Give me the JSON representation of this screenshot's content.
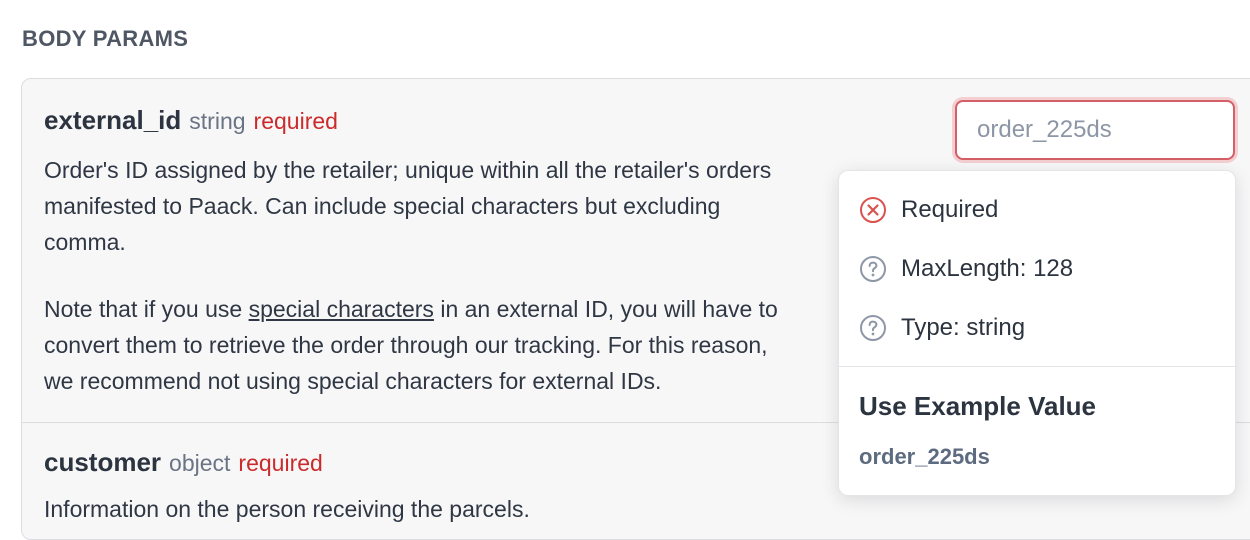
{
  "section": {
    "title": "BODY PARAMS"
  },
  "params": [
    {
      "name": "external_id",
      "type": "string",
      "required": "required",
      "desc1": [
        "Order's ID assigned by the retailer; unique within all the retailer's orders",
        "manifested to Paack. Can include special characters but excluding",
        "comma."
      ],
      "desc2_a": "Note that if you use ",
      "desc2_link": "special characters",
      "desc2_b": " in an external ID, you will have to",
      "desc2_lines": [
        "convert them to retrieve the order through our tracking. For this reason,",
        "we recommend not using special characters for external IDs."
      ]
    },
    {
      "name": "customer",
      "type": "object",
      "required": "required",
      "desc": "Information on the person receiving the parcels."
    }
  ],
  "input": {
    "placeholder": "order_225ds"
  },
  "popover": {
    "rules": [
      {
        "label": "Required",
        "icon": "error-circle-icon"
      },
      {
        "label": "MaxLength: 128",
        "icon": "help-circle-icon"
      },
      {
        "label": "Type: string",
        "icon": "help-circle-icon"
      }
    ],
    "example_title": "Use Example Value",
    "example_value": "order_225ds"
  },
  "colors": {
    "required": "#cc2b2b",
    "error_border": "#d45f66",
    "muted": "#6a7485"
  }
}
